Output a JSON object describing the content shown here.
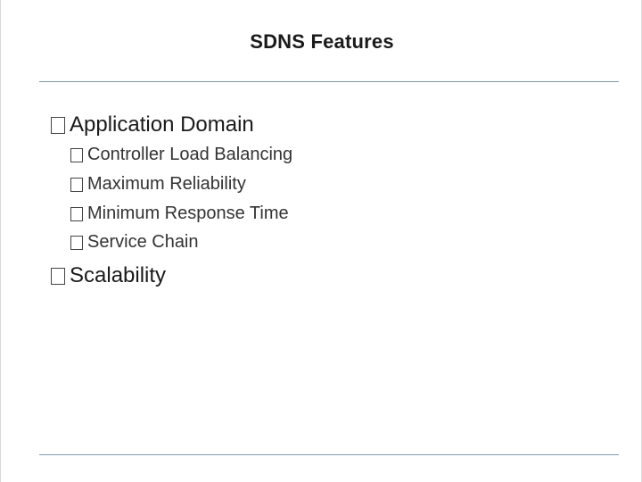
{
  "slide": {
    "title": "SDNS Features",
    "bullets": [
      {
        "label": "Application Domain",
        "children": [
          "Controller Load Balancing",
          "Maximum Reliability",
          "Minimum Response Time",
          "Service Chain"
        ]
      },
      {
        "label": "Scalability",
        "children": []
      }
    ]
  },
  "icons": {
    "bullet": "checkbox-square-icon"
  },
  "colors": {
    "rule": "#7f9bb0",
    "text": "#1a1a1a"
  }
}
